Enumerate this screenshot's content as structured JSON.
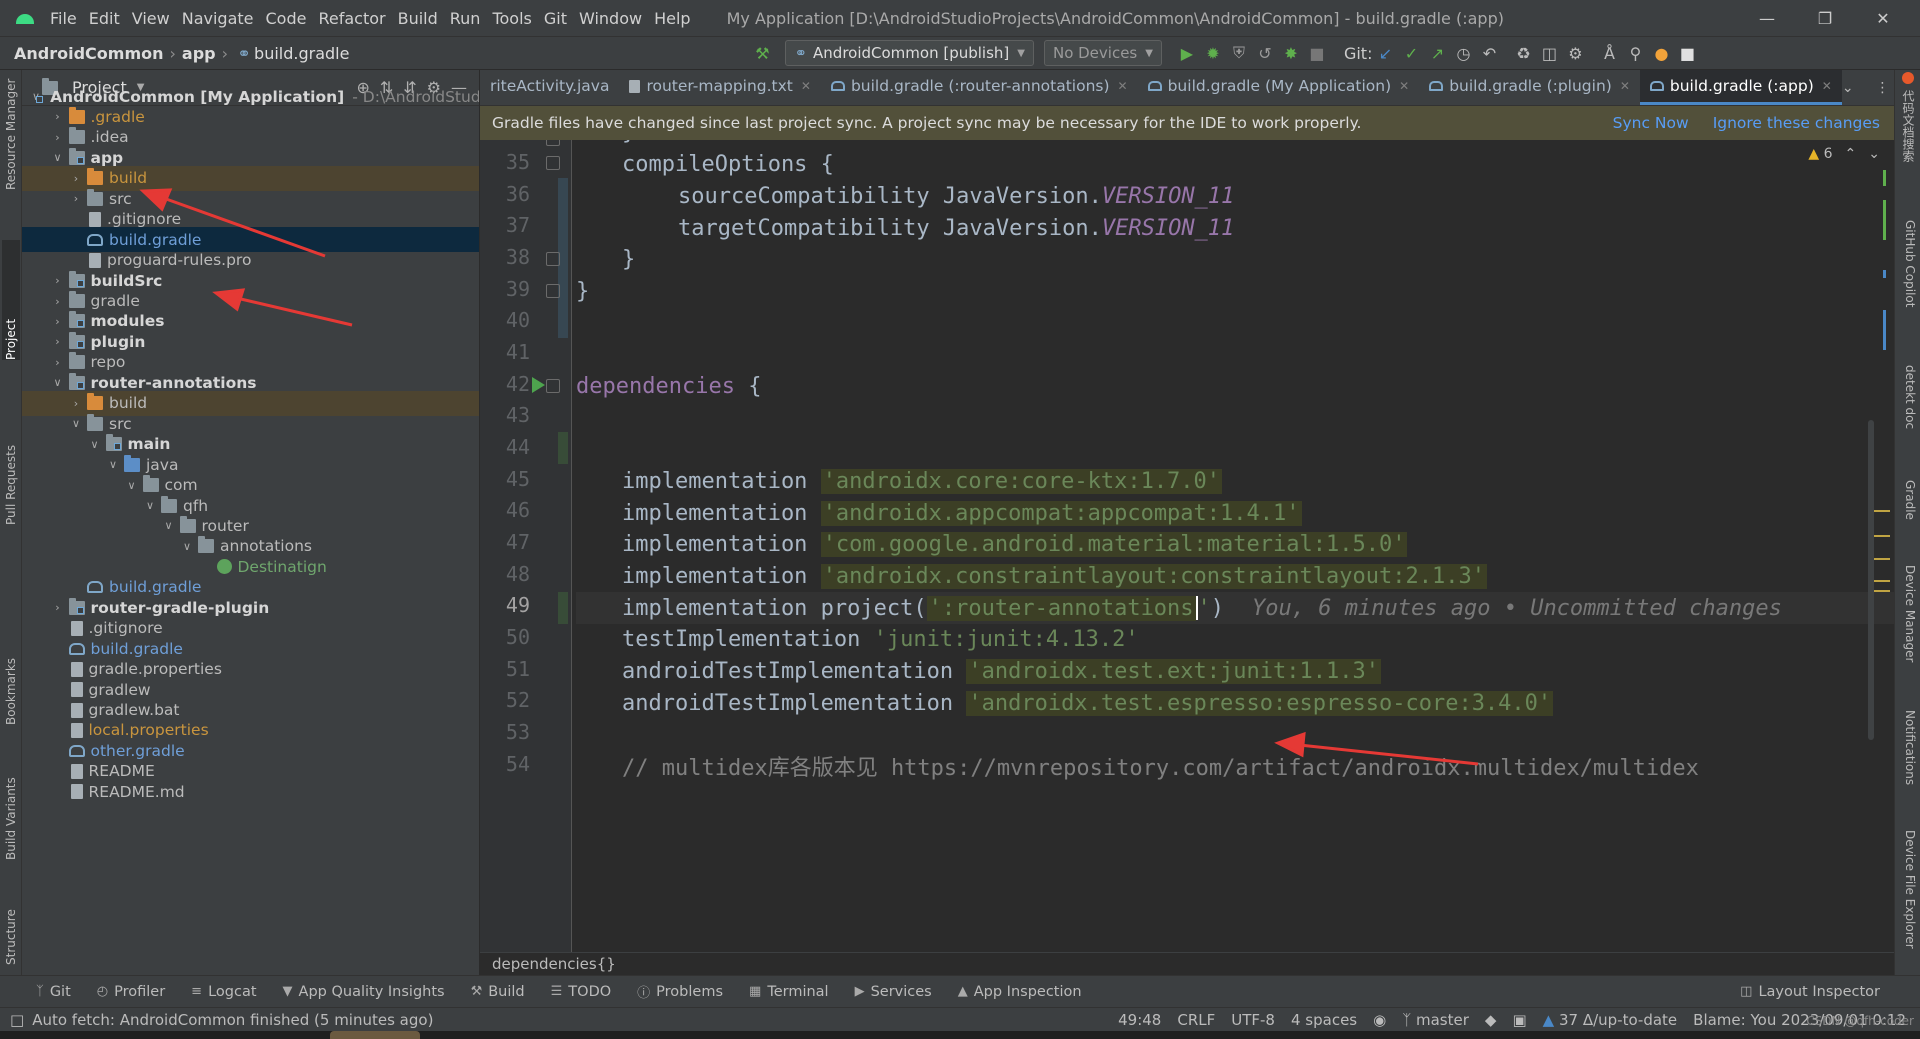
{
  "menubar": {
    "items": [
      "File",
      "Edit",
      "View",
      "Navigate",
      "Code",
      "Refactor",
      "Build",
      "Run",
      "Tools",
      "Git",
      "Window",
      "Help"
    ],
    "window_title": "My Application [D:\\AndroidStudioProjects\\AndroidCommon\\AndroidCommon] - build.gradle (:app)"
  },
  "navbar": {
    "crumbs": [
      "AndroidCommon",
      "app",
      "build.gradle"
    ],
    "run_config": "AndroidCommon [publish]",
    "devices": "No Devices",
    "git_label": "Git:"
  },
  "project_panel": {
    "title": "Project",
    "root_path": "- D:\\AndroidStudi",
    "rows": [
      {
        "label": "AndroidCommon [My Application]",
        "style": "bold"
      },
      {
        "label": ".gradle",
        "style": "orange"
      },
      {
        "label": ".idea",
        "style": ""
      },
      {
        "label": "app",
        "style": "bold"
      },
      {
        "label": "build",
        "style": "orange"
      },
      {
        "label": "src",
        "style": ""
      },
      {
        "label": ".gitignore",
        "style": ""
      },
      {
        "label": "build.gradle",
        "style": "blue"
      },
      {
        "label": "proguard-rules.pro",
        "style": ""
      },
      {
        "label": "buildSrc",
        "style": "bold"
      },
      {
        "label": "gradle",
        "style": ""
      },
      {
        "label": "modules",
        "style": "bold"
      },
      {
        "label": "plugin",
        "style": "bold"
      },
      {
        "label": "repo",
        "style": ""
      },
      {
        "label": "router-annotations",
        "style": "bold"
      },
      {
        "label": "build",
        "style": ""
      },
      {
        "label": "src",
        "style": ""
      },
      {
        "label": "main",
        "style": "bold"
      },
      {
        "label": "java",
        "style": ""
      },
      {
        "label": "com",
        "style": ""
      },
      {
        "label": "qfh",
        "style": ""
      },
      {
        "label": "router",
        "style": ""
      },
      {
        "label": "annotations",
        "style": ""
      },
      {
        "label": "Destinatign",
        "style": "green"
      },
      {
        "label": "build.gradle",
        "style": "blue"
      },
      {
        "label": "router-gradle-plugin",
        "style": "bold"
      },
      {
        "label": ".gitignore",
        "style": ""
      },
      {
        "label": "build.gradle",
        "style": "blue"
      },
      {
        "label": "gradle.properties",
        "style": ""
      },
      {
        "label": "gradlew",
        "style": ""
      },
      {
        "label": "gradlew.bat",
        "style": ""
      },
      {
        "label": "local.properties",
        "style": "orange"
      },
      {
        "label": "other.gradle",
        "style": "blue"
      },
      {
        "label": "README",
        "style": ""
      },
      {
        "label": "README.md",
        "style": ""
      }
    ]
  },
  "tabs": [
    {
      "label": "riteActivity.java",
      "active": false
    },
    {
      "label": "router-mapping.txt",
      "active": false
    },
    {
      "label": "build.gradle (:router-annotations)",
      "active": false
    },
    {
      "label": "build.gradle (My Application)",
      "active": false
    },
    {
      "label": "build.gradle (:plugin)",
      "active": false
    },
    {
      "label": "build.gradle (:app)",
      "active": true
    }
  ],
  "banner": {
    "message": "Gradle files have changed since last project sync. A project sync may be necessary for the IDE to work properly.",
    "sync_now": "Sync Now",
    "ignore": "Ignore these changes"
  },
  "editor": {
    "warnings": "6",
    "blame_inline": "You, 6 minutes ago • Uncommitted changes",
    "lines": {
      "34": "}",
      "35": "compileOptions {",
      "36a": "sourceCompatibility JavaVersion.",
      "36b": "VERSION_11",
      "37a": "targetCompatibility JavaVersion.",
      "37b": "VERSION_11",
      "38": "}",
      "39": "}",
      "42": "dependencies",
      "42b": " {",
      "45a": "implementation ",
      "45b": "'androidx.core:core-ktx:1.7.0'",
      "46a": "implementation ",
      "46b": "'androidx.appcompat:appcompat:1.4.1'",
      "47a": "implementation ",
      "47b": "'com.google.android.material:material:1.5.0'",
      "48a": "implementation ",
      "48b": "'androidx.constraintlayout:constraintlayout:2.1.3'",
      "49a": "implementation project(",
      "49b": "':router-annotations",
      "49c": "'",
      "49d": ")",
      "50a": "testImplementation ",
      "50b": "'junit:junit:4.13.2'",
      "51a": "androidTestImplementation ",
      "51b": "'androidx.test.ext:junit:1.1.3'",
      "52a": "androidTestImplementation ",
      "52b": "'androidx.test.espresso:espresso-core:3.4.0'",
      "54": "// multidex库各版本见 https://mvnrepository.com/artifact/androidx.multidex/multidex"
    }
  },
  "editor_breadcrumb": "dependencies{}",
  "tool_windows": [
    "Git",
    "Profiler",
    "Logcat",
    "App Quality Insights",
    "Build",
    "TODO",
    "Problems",
    "Terminal",
    "Services",
    "App Inspection"
  ],
  "layout_inspector": "Layout Inspector",
  "left_strip": [
    "Resource Manager",
    "Project",
    "Pull Requests",
    "Bookmarks",
    "Build Variants",
    "Structure"
  ],
  "right_strip": [
    "代码文档搜索",
    "GitHub Copilot",
    "detekt doc",
    "Gradle",
    "Device Manager",
    "Notifications",
    "Device File Explorer"
  ],
  "status": {
    "message": "Auto fetch: AndroidCommon finished (5 minutes ago)",
    "position": "49:48",
    "line_sep": "CRLF",
    "encoding": "UTF-8",
    "indent": "4 spaces",
    "branch": "master",
    "vcs": "37 Δ/up-to-date",
    "blame": "Blame: You 2023/09/01 0:12"
  },
  "watermark": "CSDN @qfh-coder",
  "colors": {
    "accent": "#4a88c7",
    "annotation_arrow": "#e53935",
    "string": "#6a8759",
    "constant": "#9876aa"
  }
}
